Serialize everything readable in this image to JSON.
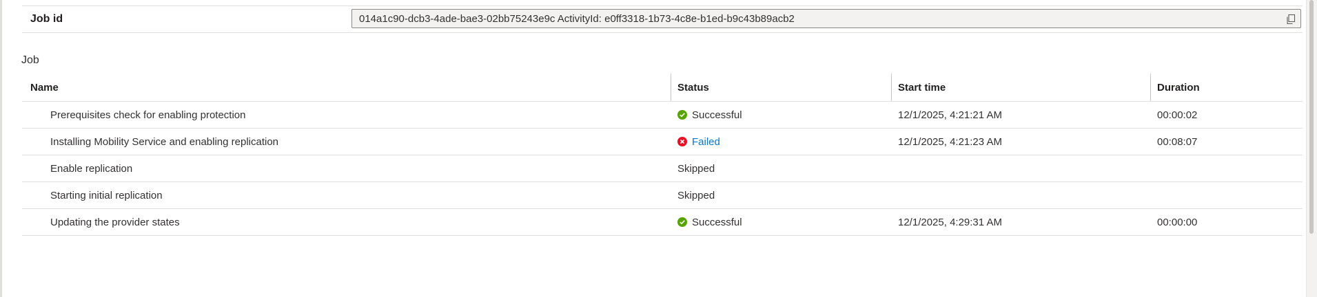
{
  "job_id": {
    "label": "Job id",
    "value": "014a1c90-dcb3-4ade-bae3-02bb75243e9c ActivityId: e0ff3318-1b73-4c8e-b1ed-b9c43b89acb2"
  },
  "section_title": "Job",
  "table": {
    "columns": [
      "Name",
      "Status",
      "Start time",
      "Duration"
    ],
    "rows": [
      {
        "name": "Prerequisites check for enabling protection",
        "status": "Successful",
        "status_icon": "success-icon",
        "start_time": "12/1/2025, 4:21:21 AM",
        "duration": "00:00:02"
      },
      {
        "name": "Installing Mobility Service and enabling replication",
        "status": "Failed",
        "status_icon": "error-icon",
        "start_time": "12/1/2025, 4:21:23 AM",
        "duration": "00:08:07"
      },
      {
        "name": "Enable replication",
        "status": "Skipped",
        "status_icon": "",
        "start_time": "",
        "duration": ""
      },
      {
        "name": "Starting initial replication",
        "status": "Skipped",
        "status_icon": "",
        "start_time": "",
        "duration": ""
      },
      {
        "name": "Updating the provider states",
        "status": "Successful",
        "status_icon": "success-icon",
        "start_time": "12/1/2025, 4:29:31 AM",
        "duration": "00:00:00"
      }
    ]
  },
  "colors": {
    "success": "#57a300",
    "error": "#e81123",
    "link": "#0078d4"
  }
}
